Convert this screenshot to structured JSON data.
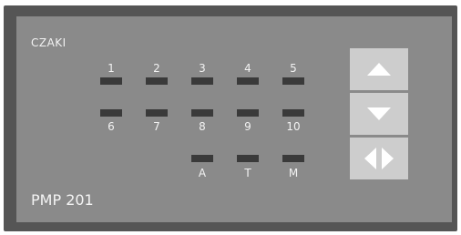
{
  "brand": {
    "name": "CZAKI"
  },
  "model": {
    "name": "PMP 201"
  },
  "channels_top": [
    "1",
    "2",
    "3",
    "4",
    "5"
  ],
  "channels_bottom": [
    "6",
    "7",
    "8",
    "9",
    "10"
  ],
  "mode_leds": [
    "A",
    "T",
    "M"
  ],
  "buttons": [
    {
      "id": "up",
      "icon": "arrow-up-icon"
    },
    {
      "id": "down",
      "icon": "arrow-down-icon"
    },
    {
      "id": "left-right",
      "icon": "arrow-left-right-icon"
    }
  ],
  "colors": {
    "panel": "#8a8a8a",
    "bezel": "#555555",
    "led_off": "#3a3a3a",
    "button": "#cdcdcd",
    "button_icon": "#ffffff",
    "text": "#f2f2f2"
  }
}
